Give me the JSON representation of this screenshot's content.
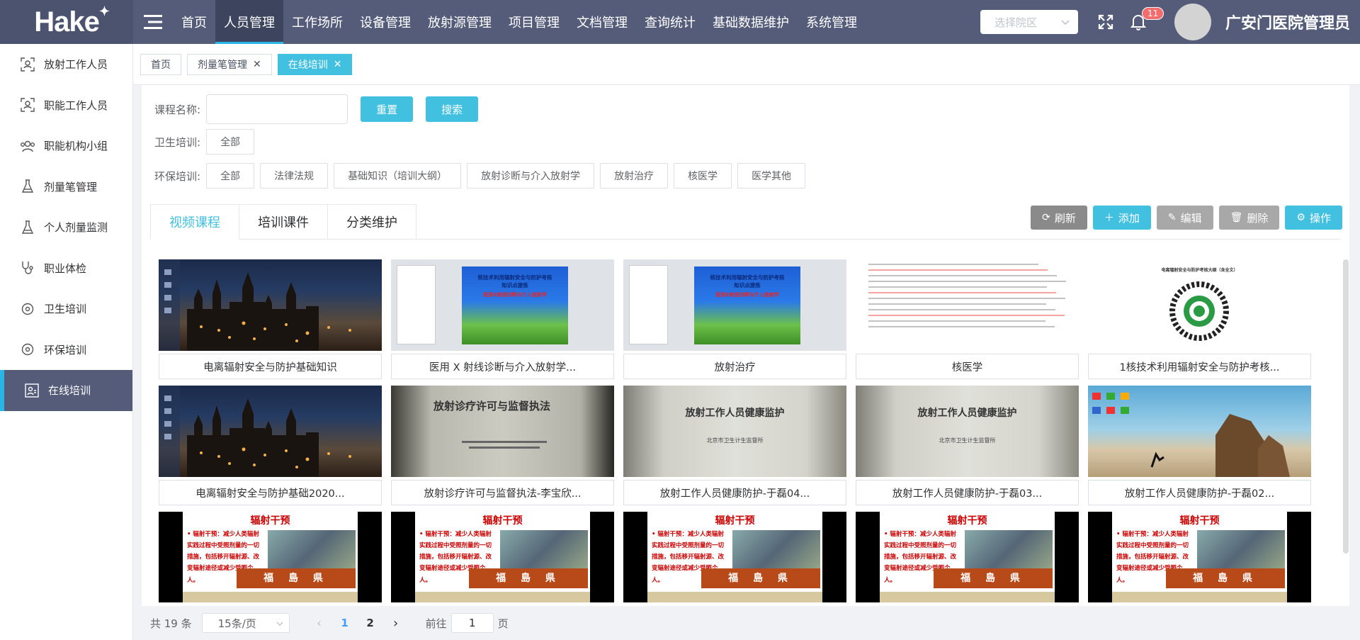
{
  "app": {
    "logo_text": "Hake",
    "logo_star": "✦",
    "hospital_select_placeholder": "选择院区",
    "notification_count": "11",
    "username": "广安门医院管理员"
  },
  "top_menu": [
    {
      "label": "首页"
    },
    {
      "label": "人员管理"
    },
    {
      "label": "工作场所"
    },
    {
      "label": "设备管理"
    },
    {
      "label": "放射源管理"
    },
    {
      "label": "项目管理"
    },
    {
      "label": "文档管理"
    },
    {
      "label": "查询统计"
    },
    {
      "label": "基础数据维护"
    },
    {
      "label": "系统管理"
    }
  ],
  "sidebar": [
    {
      "label": "放射工作人员",
      "icon": "person-scan-icon"
    },
    {
      "label": "职能工作人员",
      "icon": "person-scan-icon"
    },
    {
      "label": "职能机构小组",
      "icon": "group-icon"
    },
    {
      "label": "剂量笔管理",
      "icon": "flask-icon"
    },
    {
      "label": "个人剂量监测",
      "icon": "flask-icon"
    },
    {
      "label": "职业体检",
      "icon": "stethoscope-icon"
    },
    {
      "label": "卫生培训",
      "icon": "circle-dot-icon"
    },
    {
      "label": "环保培训",
      "icon": "circle-dot-icon"
    },
    {
      "label": "在线培训",
      "icon": "online-training-icon"
    }
  ],
  "tags": [
    {
      "label": "首页"
    },
    {
      "label": "剂量笔管理"
    },
    {
      "label": "在线培训"
    }
  ],
  "filters": {
    "course_name_label": "课程名称:",
    "course_name_value": "",
    "reset_label": "重置",
    "search_label": "搜索",
    "health_label": "卫生培训:",
    "health_options": [
      "全部"
    ],
    "env_label": "环保培训:",
    "env_options": [
      "全部",
      "法律法规",
      "基础知识（培训大纲）",
      "放射诊断与介入放射学",
      "放射治疗",
      "核医学",
      "医学其他"
    ]
  },
  "tabs": [
    "视频课程",
    "培训课件",
    "分类维护"
  ],
  "actions": [
    {
      "label": "刷新",
      "icon": "refresh-icon"
    },
    {
      "label": "添加",
      "icon": "plus-icon"
    },
    {
      "label": "编辑",
      "icon": "edit-icon"
    },
    {
      "label": "删除",
      "icon": "trash-icon"
    },
    {
      "label": "操作",
      "icon": "gear-icon"
    }
  ],
  "courses": [
    {
      "title": "电离辐射安全与防护基础知识",
      "thumb": "night"
    },
    {
      "title": "医用 X 射线诊断与介入放射学...",
      "thumb": "slide"
    },
    {
      "title": "放射治疗",
      "thumb": "slide"
    },
    {
      "title": "核医学",
      "thumb": "doc"
    },
    {
      "title": "1核技术利用辐射安全与防护考核...",
      "thumb": "qr"
    },
    {
      "title": "电离辐射安全与防护基础2020...",
      "thumb": "night"
    },
    {
      "title": "放射诊疗许可与监督执法-李宝欣...",
      "thumb": "photo-dark"
    },
    {
      "title": "放射工作人员健康防护-于磊04...",
      "thumb": "photo-gray"
    },
    {
      "title": "放射工作人员健康防护-于磊03...",
      "thumb": "photo-gray"
    },
    {
      "title": "放射工作人员健康防护-于磊02...",
      "thumb": "beach"
    },
    {
      "title": "",
      "thumb": "rad"
    },
    {
      "title": "",
      "thumb": "rad"
    },
    {
      "title": "",
      "thumb": "rad"
    },
    {
      "title": "",
      "thumb": "rad"
    },
    {
      "title": "",
      "thumb": "rad"
    }
  ],
  "thumb_text": {
    "slide_title1": "核技术利用辐射安全与防护考核",
    "slide_title2": "知识点提炼",
    "slide_sub": "医用X射线诊断与介入放射学",
    "photo_dark_title": "放射诊疗许可与监督执法",
    "photo_gray_title": "放射工作人员健康监护",
    "photo_gray_sub": "北京市卫生计生监督所",
    "rad_title": "辐射干预",
    "rad_body": "• 辐射干预：减少人类辐射实践过程中受照剂量的一切措施，包括移开辐射源、改变辐射途径或减少受照个人。",
    "rad_sign": "福 島 県",
    "qr_title": "电离辐射安全与防护考核大纲（含全文）"
  },
  "pagination": {
    "total": "共 19 条",
    "page_size": "15条/页",
    "pages": [
      "1",
      "2"
    ],
    "goto_label": "前往",
    "goto_value": "1",
    "page_unit": "页"
  }
}
